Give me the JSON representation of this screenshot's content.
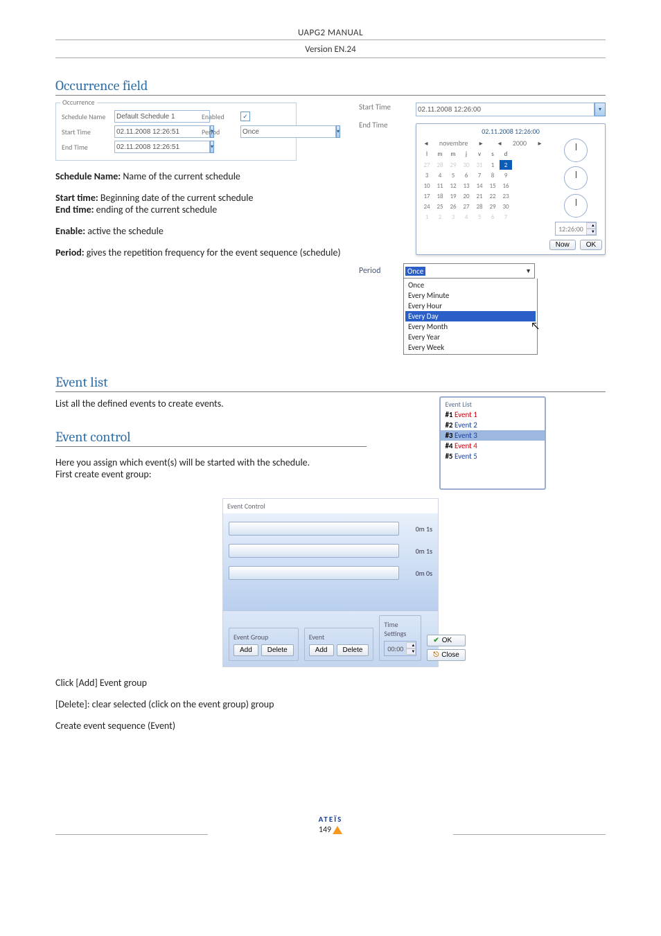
{
  "header": {
    "title": "UAPG2 MANUAL",
    "version": "Version EN.24"
  },
  "sections": {
    "occurrence": {
      "title": "Occurrence field",
      "form": {
        "legend": "Occurrence",
        "schedule_name_label": "Schedule Name",
        "schedule_name_value": "Default Schedule 1",
        "enabled_label": "Enabled",
        "start_time_label": "Start Time",
        "start_time_value": "02.11.2008 12:26:51",
        "period_label": "Period",
        "period_value": "Once",
        "end_time_label": "End Time",
        "end_time_value": "02.11.2008 12:26:51"
      },
      "desc": {
        "schedule_name_label": "Schedule Name:",
        "schedule_name_text": " Name of the current schedule",
        "start_time_label": "Start time:",
        "start_time_text": " Beginning date of the current schedule",
        "end_time_label": "End time:",
        "end_time_text": " ending of the current schedule",
        "enable_label": "Enable:",
        "enable_text": " active the schedule",
        "period_label": "Period:",
        "period_text": " gives the repetition frequency for the event sequence (schedule)"
      },
      "datetime_picker": {
        "start_label": "Start Time",
        "end_label": "End Time",
        "start_value": "02.11.2008 12:26:00",
        "popup_date": "02.11.2008 12:26:00",
        "month_nav": "novembre",
        "year_nav": "2000",
        "weekday_header": [
          "l",
          "m",
          "m",
          "j",
          "v",
          "s",
          "d"
        ],
        "grid": [
          {
            "d": "27",
            "dim": true
          },
          {
            "d": "28",
            "dim": true
          },
          {
            "d": "29",
            "dim": true
          },
          {
            "d": "30",
            "dim": true
          },
          {
            "d": "31",
            "dim": true
          },
          {
            "d": "1"
          },
          {
            "d": "2",
            "sel": true
          },
          {
            "d": "3"
          },
          {
            "d": "4"
          },
          {
            "d": "5"
          },
          {
            "d": "6"
          },
          {
            "d": "7"
          },
          {
            "d": "8"
          },
          {
            "d": "9"
          },
          {
            "d": "10"
          },
          {
            "d": "11"
          },
          {
            "d": "12"
          },
          {
            "d": "13"
          },
          {
            "d": "14"
          },
          {
            "d": "15"
          },
          {
            "d": "16"
          },
          {
            "d": "17"
          },
          {
            "d": "18"
          },
          {
            "d": "19"
          },
          {
            "d": "20"
          },
          {
            "d": "21"
          },
          {
            "d": "22"
          },
          {
            "d": "23"
          },
          {
            "d": "24"
          },
          {
            "d": "25"
          },
          {
            "d": "26"
          },
          {
            "d": "27"
          },
          {
            "d": "28"
          },
          {
            "d": "29"
          },
          {
            "d": "30"
          },
          {
            "d": "1",
            "dim": true
          },
          {
            "d": "2",
            "dim": true
          },
          {
            "d": "3",
            "dim": true
          },
          {
            "d": "4",
            "dim": true
          },
          {
            "d": "5",
            "dim": true
          },
          {
            "d": "6",
            "dim": true
          },
          {
            "d": "7",
            "dim": true
          }
        ],
        "time_value": "12:26:00",
        "now_label": "Now",
        "ok_label": "OK"
      },
      "period_dropdown": {
        "label": "Period",
        "selected": "Once",
        "options": [
          "Once",
          "Every Minute",
          "Every Hour",
          "Every Day",
          "Every Month",
          "Every Year",
          "Every Week"
        ],
        "highlight": "Every Day"
      }
    },
    "event_list": {
      "title": "Event list",
      "desc": "List all the defined events to create events.",
      "box": {
        "title": "Event List",
        "items": [
          {
            "num": "#1",
            "label": "Event 1",
            "cls": "evred"
          },
          {
            "num": "#2",
            "label": "Event 2",
            "cls": "evblue"
          },
          {
            "num": "#3",
            "label": "Event 3",
            "cls": "evblue",
            "hl": true
          },
          {
            "num": "#4",
            "label": "Event 4",
            "cls": "evred"
          },
          {
            "num": "#5",
            "label": "Event 5",
            "cls": "evblue"
          }
        ]
      }
    },
    "event_control": {
      "title": "Event control",
      "desc1": "Here you assign which event(s) will be started with the schedule.",
      "desc2": " First create event group:",
      "fig": {
        "legend": "Event Control",
        "sliders": [
          "0m 1s",
          "0m 1s",
          "0m 0s"
        ],
        "group_label": "Event Group",
        "event_label": "Event",
        "time_label": "Time Settings",
        "add": "Add",
        "delete": "Delete",
        "time_value": "00:00",
        "ok": "OK",
        "close": "Close"
      },
      "after1": "Click [Add] Event group",
      "after2": "[Delete]: clear selected (click on the event group) group",
      "after3": "Create event sequence (Event)"
    }
  },
  "footer": {
    "brand": "ATEÏS",
    "page": "149"
  }
}
